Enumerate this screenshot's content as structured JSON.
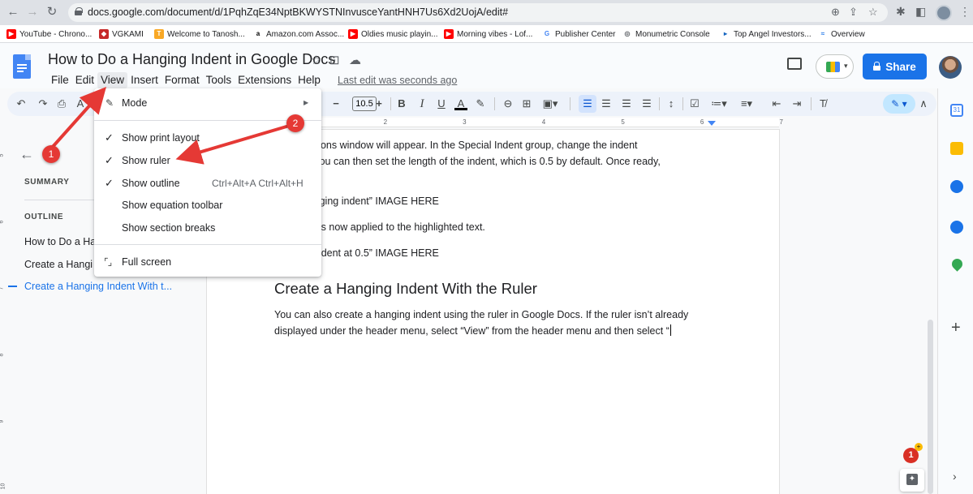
{
  "browser": {
    "url": "docs.google.com/document/d/1PqhZqE34NptBKWYSTNInvusceYantHNH7Us6Xd2UojA/edit#",
    "bookmarks": [
      {
        "label": "YouTube - Chrono...",
        "color": "#ff0000",
        "glyph": "▶"
      },
      {
        "label": "VGKAMI",
        "color": "#c62828",
        "glyph": "◆"
      },
      {
        "label": "Welcome to Tanosh...",
        "color": "#f9a825",
        "glyph": "T"
      },
      {
        "label": "Amazon.com Assoc...",
        "color": "#232f3e",
        "glyph": "a"
      },
      {
        "label": "Oldies music playin...",
        "color": "#ff0000",
        "glyph": "▶"
      },
      {
        "label": "Morning vibes - Lof...",
        "color": "#ff0000",
        "glyph": "▶"
      },
      {
        "label": "Publisher Center",
        "color": "#4285f4",
        "glyph": "G"
      },
      {
        "label": "Monumetric Console",
        "color": "#5f6368",
        "glyph": "◎"
      },
      {
        "label": "Top Angel Investors...",
        "color": "#1565c0",
        "glyph": "▸"
      },
      {
        "label": "Overview",
        "color": "#1a73e8",
        "glyph": "≈"
      }
    ]
  },
  "docs": {
    "title": "How to Do a Hanging Indent in Google Docs",
    "menus": [
      "File",
      "Edit",
      "View",
      "Insert",
      "Format",
      "Tools",
      "Extensions",
      "Help"
    ],
    "last_edit": "Last edit was seconds ago",
    "share_label": "Share",
    "font_size": "10.5",
    "accent": "#1a73e8"
  },
  "outline": {
    "summary_label": "SUMMARY",
    "outline_label": "OUTLINE",
    "items": [
      "How to Do a Ha",
      "Create a Hangi",
      "Create a Hanging Indent With t..."
    ]
  },
  "view_menu": {
    "mode_label": "Mode",
    "items": [
      {
        "label": "Show print layout",
        "checked": true
      },
      {
        "label": "Show ruler",
        "checked": true
      },
      {
        "label": "Show outline",
        "checked": true,
        "shortcut": "Ctrl+Alt+A Ctrl+Alt+H"
      },
      {
        "label": "Show equation toolbar",
        "checked": false
      },
      {
        "label": "Show section breaks",
        "checked": false
      }
    ],
    "full_screen_label": "Full screen"
  },
  "document": {
    "p1_line1": "tation Options window will appear. In the Special Indent group, change the indent",
    "p1_line2": "anging.” You can then set the length of the indent, which is 0.5 by default. Once ready,",
    "p1_line3": "y.”",
    "p2": "et the hanging indent” IMAGE HERE",
    "p3": "ng indent is now applied to the highlighted text.",
    "p4": "hanging indent at 0.5” IMAGE HERE",
    "heading": "Create a Hanging Indent With the Ruler",
    "p5_line1": "You can also create a hanging indent using the ruler in Google Docs. If the ruler isn’t already",
    "p5_line2": "displayed under the header menu, select “View” from the header menu and then select “"
  },
  "ruler_numbers": [
    "1",
    "2",
    "3",
    "4",
    "5",
    "6",
    "7"
  ],
  "annotations": {
    "step1": "1",
    "step2": "2",
    "arrow_color": "#e53935"
  },
  "notifications": {
    "count": "1"
  }
}
